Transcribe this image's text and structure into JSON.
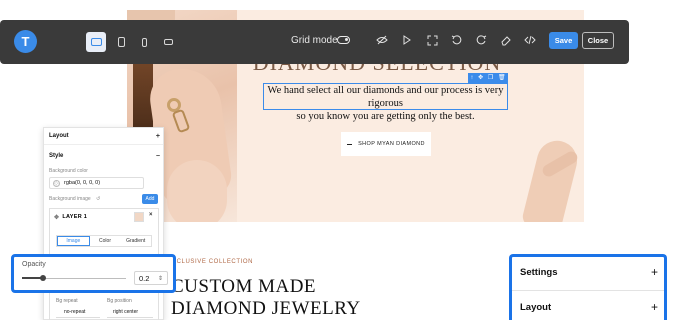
{
  "toolbar": {
    "logo_letter": "T",
    "grid_mode_label": "Grid mode",
    "save_label": "Save",
    "close_label": "Close"
  },
  "page": {
    "hero_title": "DIAMOND SELECTION",
    "hero_text_line1": "We hand select all our diamonds and our process is very rigorous",
    "hero_text_line2": "so you know you are getting only the best.",
    "shop_button": "SHOP MYAN DIAMOND",
    "collection_label": "XCLUSIVE COLLECTION",
    "custom_title_line1": "CUSTOM MADE",
    "custom_title_line2": "DIAMOND JEWELRY"
  },
  "style_panel": {
    "layout_label": "Layout",
    "style_label": "Style",
    "bg_color_label": "Background color",
    "bg_color_value": "rgba(0, 0, 0, 0)",
    "bg_image_label": "Background image",
    "add_label": "Add",
    "layer_label": "LAYER 1",
    "tabs": [
      "Image",
      "Color",
      "Gradient"
    ],
    "active_tab": "Image",
    "bg_repeat_label": "Bg repeat",
    "bg_repeat_value": "no-repeat",
    "bg_position_label": "Bg position",
    "bg_position_value": "right center"
  },
  "opacity": {
    "label": "Opacity",
    "value": "0.2",
    "level": 0.2
  },
  "right_panel": {
    "settings_label": "Settings",
    "layout_label": "Layout"
  },
  "colors": {
    "accent": "#3a8be8",
    "highlight": "#1a73e8",
    "toolbar_bg": "#3a3a3a",
    "hero_bg": "#fbece1"
  }
}
